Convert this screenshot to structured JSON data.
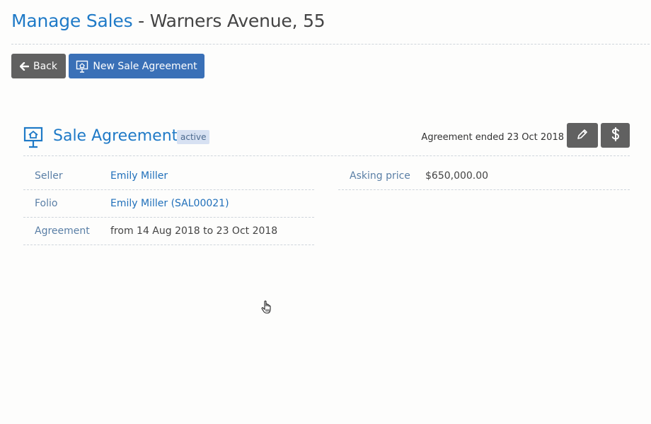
{
  "header": {
    "section": "Manage Sales",
    "separator": " - ",
    "address": "Warners Avenue, 55"
  },
  "toolbar": {
    "back_label": "Back",
    "new_label": "New Sale Agreement"
  },
  "panel": {
    "title": "Sale Agreement",
    "status": "active",
    "ended_text": "Agreement ended 23 Oct 2018"
  },
  "details_left": [
    {
      "label": "Seller",
      "value": "Emily Miller"
    },
    {
      "label": "Folio",
      "value": "Emily Miller (SAL00021)"
    },
    {
      "label": "Agreement",
      "value": "from 14 Aug 2018 to 23 Oct 2018"
    }
  ],
  "details_right": [
    {
      "label": "Asking price",
      "value": "$650,000.00"
    }
  ],
  "icons": {
    "back": "arrow-left-icon",
    "new": "sale-sign-icon",
    "edit": "pencil-icon",
    "money": "dollar-icon",
    "cursor": "hand-pointer-icon"
  },
  "colors": {
    "accent": "#1f7ac7",
    "primary_button": "#3a70b7",
    "default_button": "#616161",
    "badge_bg": "#d7e1f2"
  }
}
